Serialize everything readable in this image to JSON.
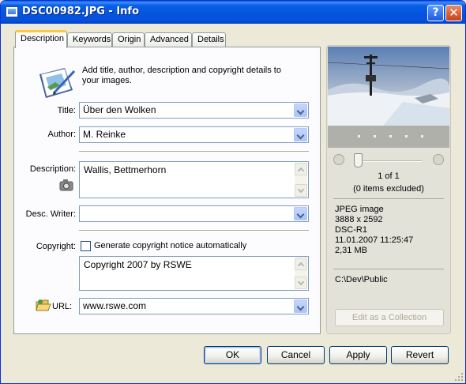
{
  "window": {
    "title": "DSC00982.JPG - Info",
    "help": "?",
    "close": "✕"
  },
  "tabs": [
    "Description",
    "Keywords",
    "Origin",
    "Advanced",
    "Details"
  ],
  "description": {
    "intro": "Add title, author, description and copyright details to your images.",
    "title_label": "Title:",
    "title_value": "Über den Wolken",
    "author_label": "Author:",
    "author_value": "M. Reinke",
    "description_label": "Description:",
    "description_value": "Wallis, Bettmerhorn",
    "desc_writer_label": "Desc. Writer:",
    "desc_writer_value": "",
    "copyright_label": "Copyright:",
    "copyright_auto_label": "Generate copyright notice automatically",
    "copyright_auto_checked": false,
    "copyright_value": "Copyright 2007 by RSWE",
    "url_label": "URL:",
    "url_value": "www.rswe.com"
  },
  "preview": {
    "counter": "1 of 1",
    "excluded": "(0 items excluded)",
    "info_lines": [
      "JPEG image",
      "3888 x 2592",
      "DSC-R1",
      "11.01.2007 11:25:47",
      "2,31 MB"
    ],
    "path": "C:\\Dev\\Public",
    "edit_collection": "Edit as a Collection"
  },
  "buttons": {
    "ok": "OK",
    "cancel": "Cancel",
    "apply": "Apply",
    "revert": "Revert"
  },
  "icons": [
    "app-icon",
    "help-icon",
    "close-icon",
    "notebook-icon",
    "camera-icon",
    "folder-icon",
    "first-icon",
    "last-icon",
    "dropdown-arrow-icon",
    "resize-grip-icon"
  ]
}
